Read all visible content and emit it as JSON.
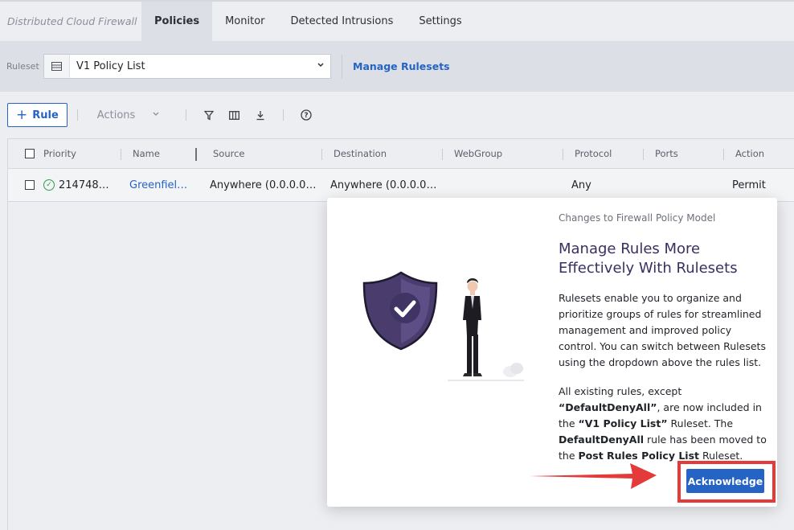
{
  "nav": {
    "product": "Distributed Cloud Firewall",
    "tabs": [
      {
        "label": "Policies",
        "active": true
      },
      {
        "label": "Monitor",
        "active": false
      },
      {
        "label": "Detected Intrusions",
        "active": false
      },
      {
        "label": "Settings",
        "active": false
      }
    ]
  },
  "ruleset": {
    "label": "Ruleset",
    "selected": "V1 Policy List",
    "manage_link": "Manage Rulesets"
  },
  "toolbar": {
    "add_rule": "Rule",
    "actions": "Actions"
  },
  "table": {
    "columns": [
      "Priority",
      "Name",
      "Source",
      "Destination",
      "WebGroup",
      "Protocol",
      "Ports",
      "Action"
    ],
    "rows": [
      {
        "priority": "214748…",
        "name": "Greenfiel…",
        "source": "Anywhere (0.0.0.0…",
        "destination": "Anywhere (0.0.0.0…",
        "webgroup": "",
        "protocol": "Any",
        "ports": "",
        "action": "Permit"
      }
    ]
  },
  "modal": {
    "eyebrow": "Changes to Firewall Policy Model",
    "title": "Manage Rules More Effectively With Rulesets",
    "para1": "Rulesets enable you to organize and prioritize groups of rules for streamlined management and improved policy control. You can switch between Rulesets using the dropdown above the rules list.",
    "para2_parts": {
      "a": "All existing rules, except ",
      "b": "“DefaultDenyAll”",
      "c": ", are now included in the ",
      "d": "“V1 Policy List”",
      "e": " Ruleset. The ",
      "f": "DefaultDenyAll",
      "g": " rule has been moved to the ",
      "h": "Post Rules Policy List",
      "i": " Ruleset."
    },
    "acknowledge": "Acknowledge"
  },
  "colors": {
    "accent": "#2563c4",
    "highlight": "#e43a3a",
    "shield": "#4a3d6e",
    "success": "#2e9b4a"
  },
  "icons": [
    "list-icon",
    "chevron-down-icon",
    "plus-icon",
    "filter-icon",
    "columns-icon",
    "download-icon",
    "help-icon",
    "check-circle-icon",
    "shield-check-icon"
  ]
}
